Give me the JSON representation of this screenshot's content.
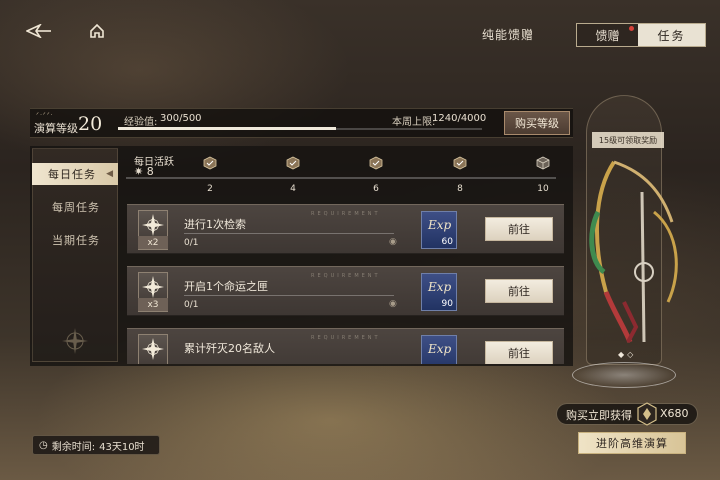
{
  "header": {
    "tabs": [
      {
        "label": "纯能馈赠",
        "active": false
      },
      {
        "label": "馈赠",
        "active": false,
        "badge": "red-dot"
      },
      {
        "label": "任务",
        "active": true
      }
    ]
  },
  "level": {
    "subtitle": "ᐟᐧᐟᐟᐧ",
    "label": "演算等级",
    "value": "20",
    "exp_label": "经验值:",
    "exp_value": "300/500",
    "exp_progress": 0.6,
    "weekly_cap_label": "本周上限:",
    "weekly_cap_value": "1240/4000",
    "buy_button": "购买等级"
  },
  "sidebar": {
    "items": [
      {
        "label": "每日任务",
        "active": true
      },
      {
        "label": "每周任务",
        "active": false
      },
      {
        "label": "当期任务",
        "active": false
      }
    ]
  },
  "activity": {
    "label": "每日活跃",
    "value": "8",
    "milestones": [
      "2",
      "4",
      "6",
      "8",
      "10"
    ]
  },
  "quests": [
    {
      "title": "进行1次检索",
      "multiplier": "x2",
      "progress": "0/1",
      "reward_amount": "60",
      "go_label": "前往",
      "tag": "REQUIREMENT"
    },
    {
      "title": "开启1个命运之匣",
      "multiplier": "x3",
      "progress": "0/1",
      "reward_amount": "90",
      "go_label": "前往",
      "tag": "REQUIREMENT"
    },
    {
      "title": "累计歼灭20名敌人",
      "multiplier": "",
      "progress": "",
      "reward_amount": "",
      "go_label": "前往",
      "tag": "REQUIREMENT"
    }
  ],
  "reward_card": {
    "label": "15级可领取奖励"
  },
  "purchase": {
    "label": "购买立即获得",
    "value": "X680",
    "advance_button": "进阶高维演算"
  },
  "footer": {
    "time_left_label": "剩余时间:",
    "time_left_value": "43天10时"
  },
  "colors": {
    "accent_light": "#efe5cf",
    "reward_blue": "#2f4276",
    "alert_red": "#d6423a"
  }
}
